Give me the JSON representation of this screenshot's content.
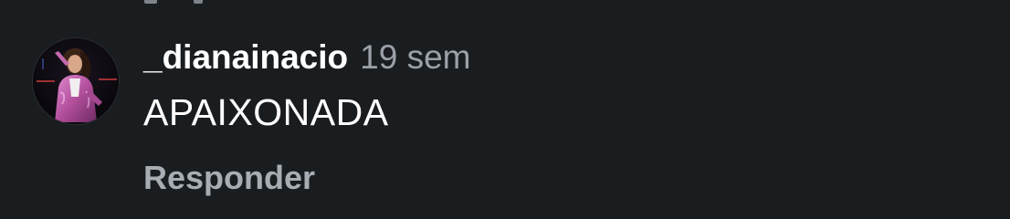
{
  "comment": {
    "username": "_dianainacio",
    "time_ago": "19 sem",
    "text": "APAIXONADA",
    "reply_label": "Responder"
  },
  "colors": {
    "background": "#1a1d20",
    "username": "#ffffff",
    "time": "#9aa1a8",
    "reply": "#a7adb3",
    "avatar_jacket": "#c05aa8"
  },
  "icons": {
    "avatar": "profile-photo-avatar"
  }
}
